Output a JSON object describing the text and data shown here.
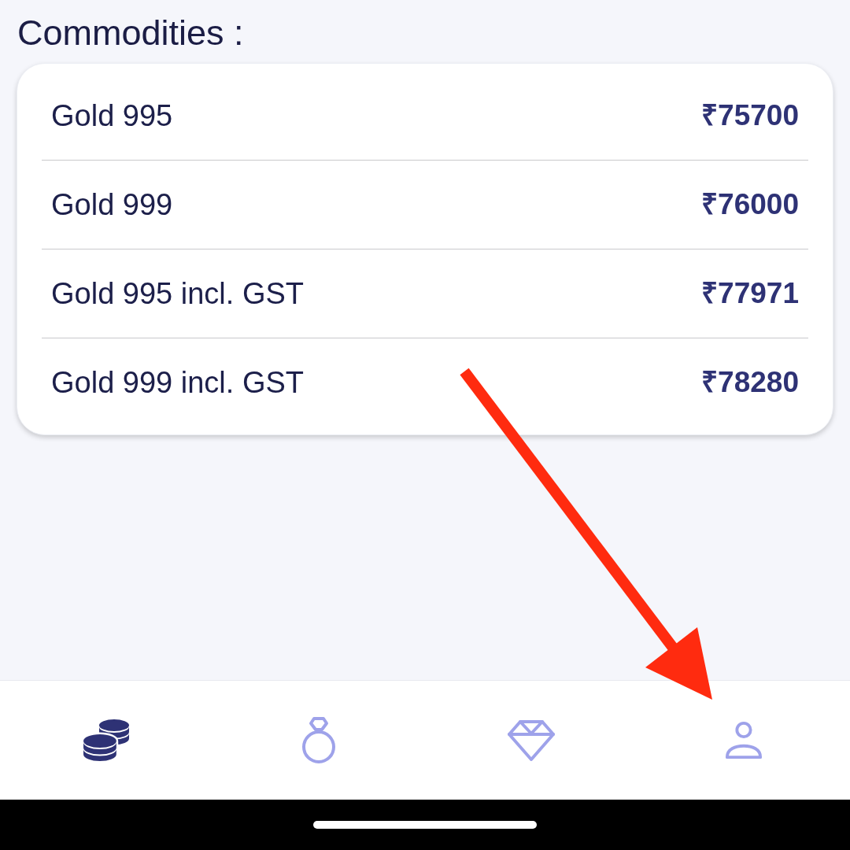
{
  "title": "Commodities :",
  "commodities": [
    {
      "name": "Gold 995",
      "price": "₹75700"
    },
    {
      "name": "Gold 999",
      "price": "₹76000"
    },
    {
      "name": "Gold 995 incl. GST",
      "price": "₹77971"
    },
    {
      "name": "Gold 999 incl. GST",
      "price": "₹78280"
    }
  ],
  "nav_items": [
    {
      "selected": true
    },
    {
      "selected": false
    },
    {
      "selected": false
    },
    {
      "selected": false
    }
  ],
  "annotations": [
    {
      "kind": "arrow"
    }
  ]
}
